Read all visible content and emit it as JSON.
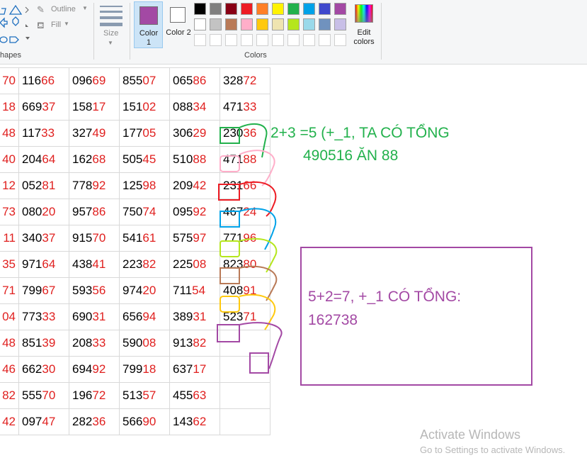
{
  "ribbon": {
    "shapes_group_label": "hapes",
    "outline_label": "Outline",
    "fill_label": "Fill",
    "size_label": "Size",
    "color1_label": "Color 1",
    "color2_label": "Color 2",
    "colors_group_label": "Colors",
    "edit_colors_label": "Edit colors",
    "color1_value": "#a349a4",
    "color2_value": "#ffffff",
    "palette_row1": [
      "#000000",
      "#7f7f7f",
      "#880015",
      "#ed1c24",
      "#ff7f27",
      "#fff200",
      "#22b14c",
      "#00a2e8",
      "#3f48cc",
      "#a349a4"
    ],
    "palette_row2": [
      "#ffffff",
      "#c3c3c3",
      "#b97a57",
      "#ffaec9",
      "#ffc90e",
      "#efe4b0",
      "#b5e61d",
      "#99d9ea",
      "#7092be",
      "#c8bfe7"
    ]
  },
  "table": {
    "rows": [
      [
        {
          "b": "",
          "r": "70"
        },
        {
          "b": "116",
          "r": "66"
        },
        {
          "b": "096",
          "r": "69"
        },
        {
          "b": "855",
          "r": "07"
        },
        {
          "b": "065",
          "r": "86"
        },
        {
          "b": "328",
          "r": "72"
        }
      ],
      [
        {
          "b": "",
          "r": "18"
        },
        {
          "b": "669",
          "r": "37"
        },
        {
          "b": "158",
          "r": "17"
        },
        {
          "b": "151",
          "r": "02"
        },
        {
          "b": "088",
          "r": "34"
        },
        {
          "b": "471",
          "r": "33"
        }
      ],
      [
        {
          "b": "",
          "r": "48"
        },
        {
          "b": "117",
          "r": "33"
        },
        {
          "b": "327",
          "r": "49"
        },
        {
          "b": "177",
          "r": "05"
        },
        {
          "b": "306",
          "r": "29"
        },
        {
          "b": "230",
          "r": "36"
        }
      ],
      [
        {
          "b": "",
          "r": "40"
        },
        {
          "b": "204",
          "r": "64"
        },
        {
          "b": "162",
          "r": "68"
        },
        {
          "b": "505",
          "r": "45"
        },
        {
          "b": "510",
          "r": "88"
        },
        {
          "b": "471",
          "r": "88"
        }
      ],
      [
        {
          "b": "",
          "r": "12"
        },
        {
          "b": "052",
          "r": "81"
        },
        {
          "b": "778",
          "r": "92"
        },
        {
          "b": "125",
          "r": "98"
        },
        {
          "b": "209",
          "r": "42"
        },
        {
          "b": "231",
          "r": "66"
        }
      ],
      [
        {
          "b": "",
          "r": "73"
        },
        {
          "b": "080",
          "r": "20"
        },
        {
          "b": "957",
          "r": "86"
        },
        {
          "b": "750",
          "r": "74"
        },
        {
          "b": "095",
          "r": "92"
        },
        {
          "b": "467",
          "r": "24"
        }
      ],
      [
        {
          "b": "",
          "r": "11"
        },
        {
          "b": "340",
          "r": "37"
        },
        {
          "b": "915",
          "r": "70"
        },
        {
          "b": "541",
          "r": "61"
        },
        {
          "b": "575",
          "r": "97"
        },
        {
          "b": "771",
          "r": "96"
        }
      ],
      [
        {
          "b": "",
          "r": "35"
        },
        {
          "b": "971",
          "r": "64"
        },
        {
          "b": "438",
          "r": "41"
        },
        {
          "b": "223",
          "r": "82"
        },
        {
          "b": "225",
          "r": "08"
        },
        {
          "b": "823",
          "r": "80"
        }
      ],
      [
        {
          "b": "",
          "r": "71"
        },
        {
          "b": "799",
          "r": "67"
        },
        {
          "b": "593",
          "r": "56"
        },
        {
          "b": "974",
          "r": "20"
        },
        {
          "b": "711",
          "r": "54"
        },
        {
          "b": "408",
          "r": "91"
        }
      ],
      [
        {
          "b": "",
          "r": "04"
        },
        {
          "b": "773",
          "r": "33"
        },
        {
          "b": "690",
          "r": "31"
        },
        {
          "b": "656",
          "r": "94"
        },
        {
          "b": "389",
          "r": "31"
        },
        {
          "b": "523",
          "r": "71"
        }
      ],
      [
        {
          "b": "",
          "r": "48"
        },
        {
          "b": "851",
          "r": "39"
        },
        {
          "b": "208",
          "r": "33"
        },
        {
          "b": "590",
          "r": "08"
        },
        {
          "b": "913",
          "r": "82"
        },
        {
          "b": "",
          "r": ""
        }
      ],
      [
        {
          "b": "",
          "r": "46"
        },
        {
          "b": "662",
          "r": "30"
        },
        {
          "b": "694",
          "r": "92"
        },
        {
          "b": "799",
          "r": "18"
        },
        {
          "b": "637",
          "r": "17"
        },
        {
          "b": "",
          "r": ""
        }
      ],
      [
        {
          "b": "",
          "r": "82"
        },
        {
          "b": "555",
          "r": "70"
        },
        {
          "b": "196",
          "r": "72"
        },
        {
          "b": "513",
          "r": "57"
        },
        {
          "b": "455",
          "r": "63"
        },
        {
          "b": "",
          "r": ""
        }
      ],
      [
        {
          "b": "",
          "r": "42"
        },
        {
          "b": "097",
          "r": "47"
        },
        {
          "b": "282",
          "r": "36"
        },
        {
          "b": "566",
          "r": "90"
        },
        {
          "b": "143",
          "r": "62"
        },
        {
          "b": "",
          "r": ""
        }
      ]
    ]
  },
  "annotations": {
    "green_line1": "2+3 =5 (+_1, TA CÓ TỔNG",
    "green_line2": "490516 ĂN 88",
    "purple_line1": "5+2=7, +_1 CÓ TỔNG:",
    "purple_line2": "162738",
    "green_color": "#22b14c",
    "purple_color": "#a349a4"
  },
  "watermark": {
    "title": "Activate Windows",
    "subtitle": "Go to Settings to activate Windows."
  }
}
